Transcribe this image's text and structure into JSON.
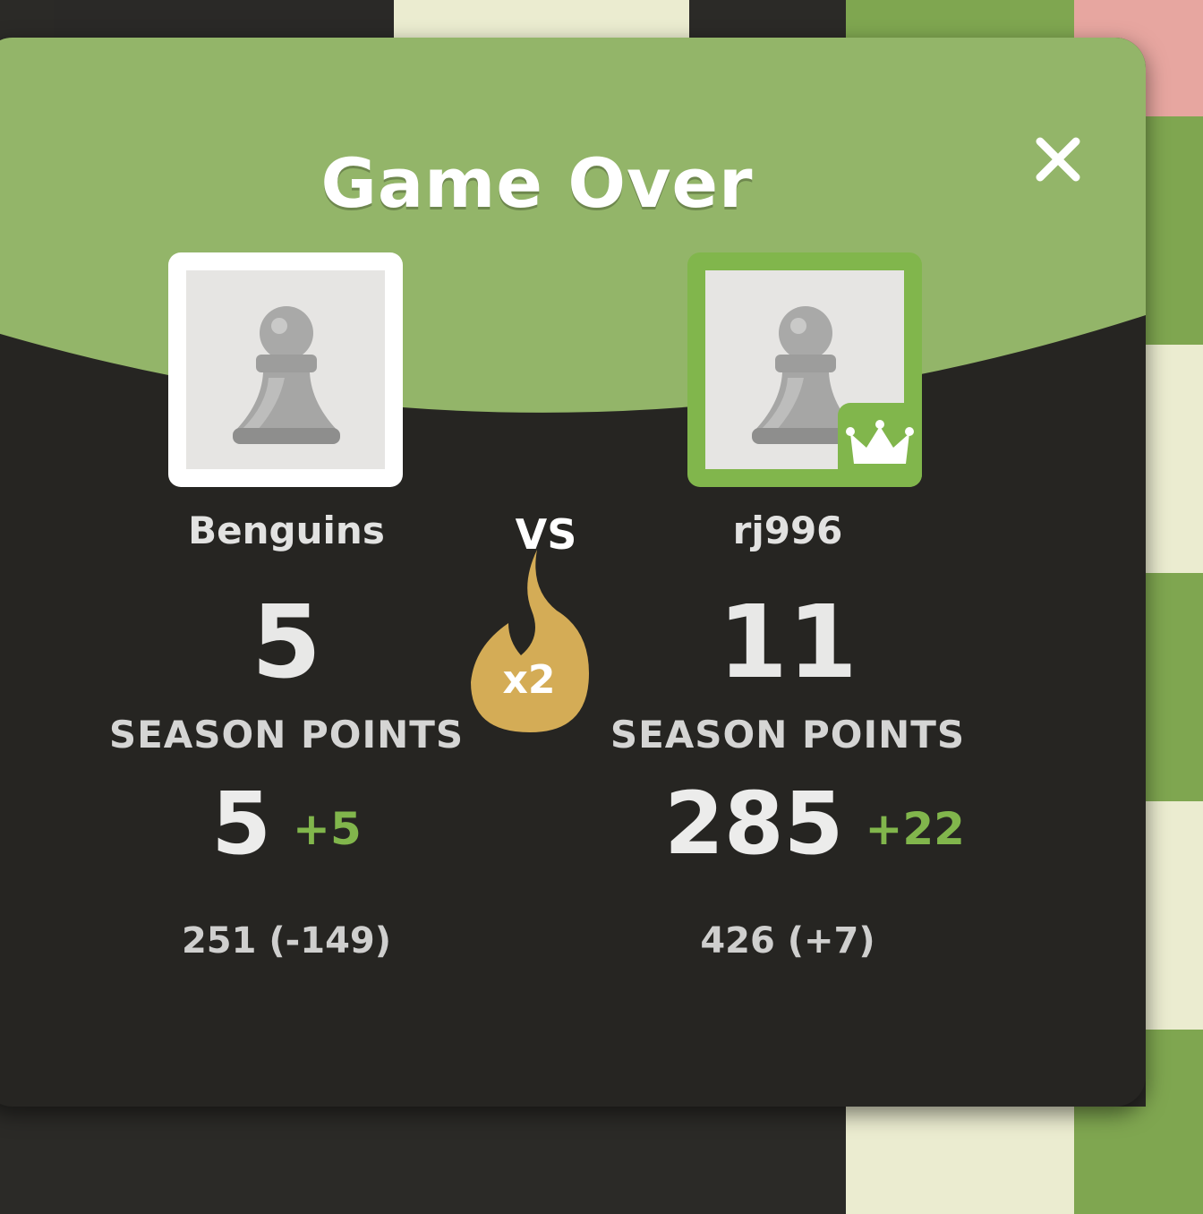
{
  "modal": {
    "title": "Game Over",
    "close_label": "close"
  },
  "vs_label": "VS",
  "multiplier": "x2",
  "players": [
    {
      "name": "Benguins",
      "score": "5",
      "season_label": "SEASON POINTS",
      "season_points": "5",
      "season_delta": "+5",
      "rating": "251 (-149)"
    },
    {
      "name": "rj996",
      "score": "11",
      "season_label": "SEASON POINTS",
      "season_points": "285",
      "season_delta": "+22",
      "rating": "426 (+7)"
    }
  ],
  "colors": {
    "accent_green": "#81b64c",
    "header_green": "#93b569",
    "panel_dark": "#262522",
    "streak_gold": "#d4ac56"
  },
  "icons": [
    "pawn-icon",
    "crown-icon",
    "flame-icon",
    "close-icon"
  ]
}
